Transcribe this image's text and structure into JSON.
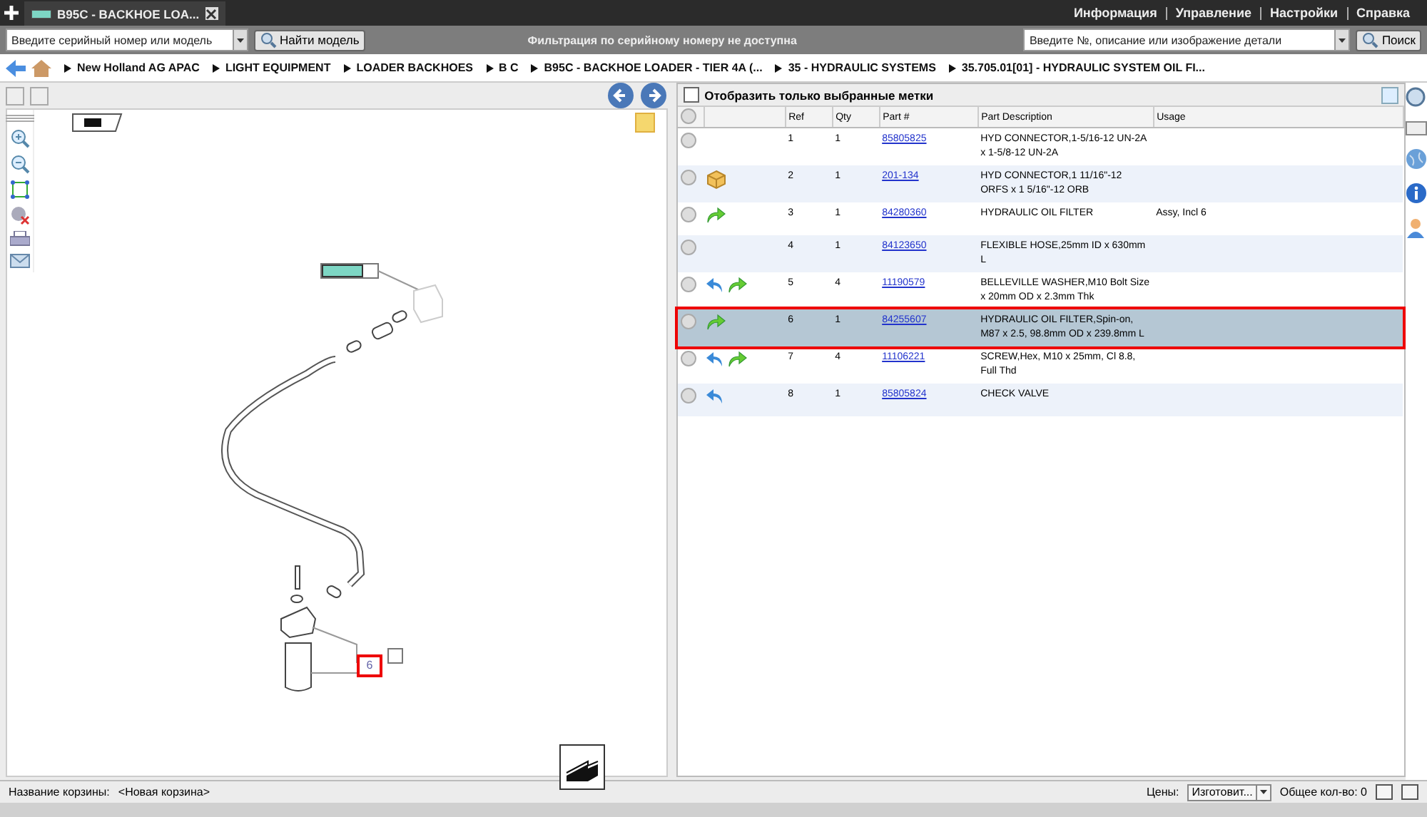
{
  "tabs": [
    {
      "label": "B95C - BACKHOE LOA...",
      "selected": true
    }
  ],
  "top_menu": [
    "Информация",
    "Управление",
    "Настройки",
    "Справка"
  ],
  "toolbar": {
    "serial_placeholder": "Введите серийный номер или модель",
    "find_button": "Найти модель",
    "filter_notice": "Фильтрация по серийному номеру не доступна",
    "part_placeholder": "Введите №, описание или изображение детали",
    "search_button": "Поиск"
  },
  "breadcrumb": [
    "New Holland AG APAC",
    "LIGHT EQUIPMENT",
    "LOADER BACKHOES",
    "B C",
    "B95C - BACKHOE LOADER - TIER 4A (...",
    "35 - HYDRAULIC SYSTEMS",
    "35.705.01[01] - HYDRAULIC SYSTEM OIL FI..."
  ],
  "diagram": {
    "highlighted_callout": "6"
  },
  "parts": {
    "filter_label": "Отобразить только выбранные метки",
    "filter_checked": false,
    "columns": [
      "Ref",
      "Qty",
      "Part #",
      "Part Description",
      "Usage"
    ],
    "rows": [
      {
        "ref": "1",
        "qty": "1",
        "part": "85805825",
        "description": "HYD CONNECTOR,1-5/16-12 UN-2A x 1-5/8-12 UN-2A",
        "selected": false
      },
      {
        "ref": "2",
        "qty": "1",
        "part": "201-134",
        "description": "HYD CONNECTOR,1 11/16\"-12 ORFS x 1 5/16\"-12 ORB",
        "icons": [
          {
            "kind": "box"
          }
        ],
        "selected": false
      },
      {
        "ref": "3",
        "qty": "1",
        "part": "84280360",
        "description": "HYDRAULIC OIL FILTER",
        "usage": "Assy, Incl 6",
        "icons": [
          {
            "kind": "forward"
          }
        ],
        "selected": false
      },
      {
        "ref": "4",
        "qty": "1",
        "part": "84123650",
        "description": "FLEXIBLE HOSE,25mm ID x 630mm L",
        "selected": false
      },
      {
        "ref": "5",
        "qty": "4",
        "part": "11190579",
        "description": "BELLEVILLE WASHER,M10 Bolt Size x 20mm OD x 2.3mm Thk",
        "icons": [
          {
            "kind": "back"
          },
          {
            "kind": "forward"
          }
        ],
        "selected": false
      },
      {
        "ref": "6",
        "qty": "1",
        "part": "84255607",
        "description": "HYDRAULIC OIL FILTER,Spin-on, M87 x 2.5, 98.8mm OD x 239.8mm L",
        "icons": [
          {
            "kind": "forward"
          }
        ],
        "selected": true
      },
      {
        "ref": "7",
        "qty": "4",
        "part": "11106221",
        "description": "SCREW,Hex, M10 x 25mm, Cl 8.8, Full Thd",
        "icons": [
          {
            "kind": "back"
          },
          {
            "kind": "forward"
          }
        ],
        "selected": false
      },
      {
        "ref": "8",
        "qty": "1",
        "part": "85805824",
        "description": "CHECK VALVE",
        "icons": [
          {
            "kind": "back"
          }
        ],
        "selected": false
      }
    ]
  },
  "status_bar": {
    "basket_label": "Название корзины:",
    "basket_name": "<Новая корзина>",
    "prices_label": "Цены:",
    "prices_value": "Изготовит...",
    "total": "Общее кол-во: 0"
  }
}
